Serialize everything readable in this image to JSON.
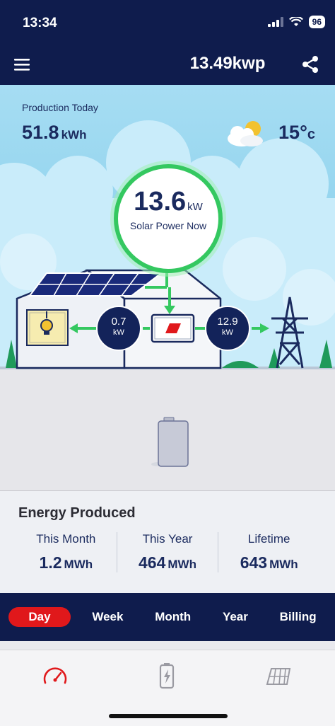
{
  "status_bar": {
    "time": "13:34",
    "battery": "96"
  },
  "header": {
    "title": "13.49kwp"
  },
  "production": {
    "label": "Production Today",
    "value": "51.8",
    "unit": "kWh"
  },
  "weather": {
    "temp_value": "15°",
    "temp_unit": "c",
    "icon": "partly-cloudy-icon"
  },
  "solar_now": {
    "value": "13.6",
    "unit": "kW",
    "label": "Solar Power Now"
  },
  "flows": {
    "to_home": {
      "value": "0.7",
      "unit": "kW"
    },
    "to_grid": {
      "value": "12.9",
      "unit": "kW"
    }
  },
  "energy_produced": {
    "title": "Energy Produced",
    "this_month": {
      "label": "This Month",
      "value": "1.2",
      "unit": "MWh"
    },
    "this_year": {
      "label": "This Year",
      "value": "464",
      "unit": "MWh"
    },
    "lifetime": {
      "label": "Lifetime",
      "value": "643",
      "unit": "MWh"
    }
  },
  "tabs": [
    {
      "label": "Day",
      "active": true
    },
    {
      "label": "Week"
    },
    {
      "label": "Month"
    },
    {
      "label": "Year"
    },
    {
      "label": "Billing"
    }
  ],
  "bottom_nav": [
    "gauge-icon",
    "battery-icon",
    "solar-panel-icon"
  ],
  "colors": {
    "navy": "#0f1c4d",
    "accent_red": "#e0181b",
    "green": "#34c860",
    "sky": "#8fd3ee"
  }
}
